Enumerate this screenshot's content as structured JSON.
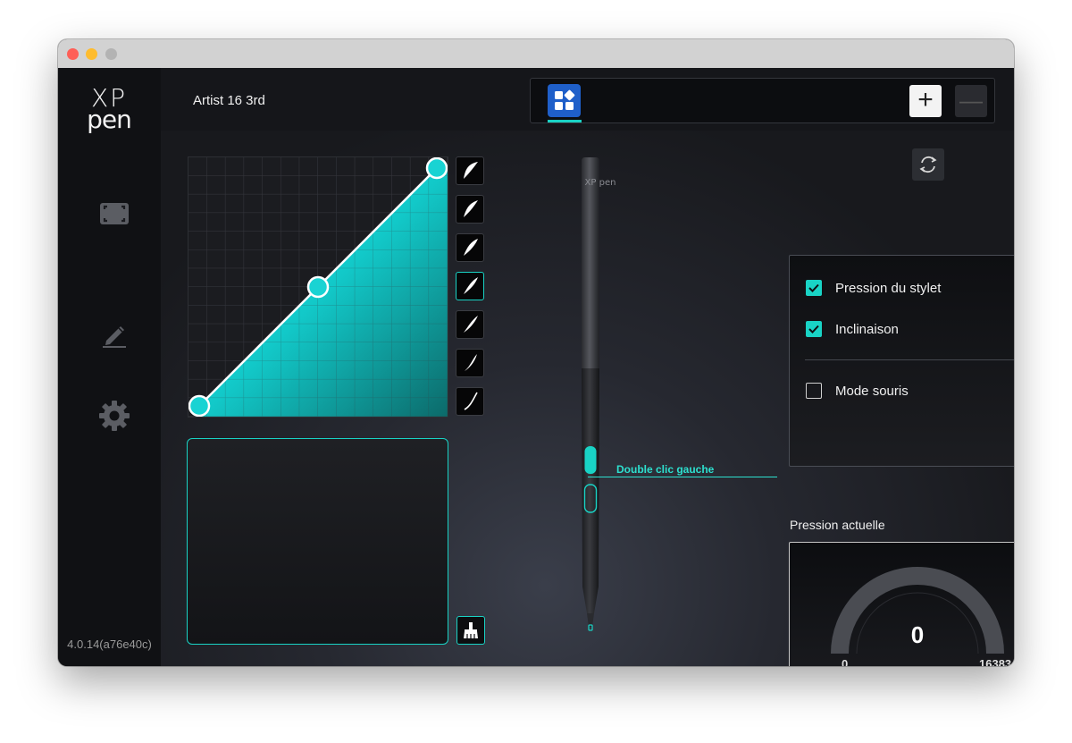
{
  "window": {
    "titlebar": {
      "buttons": [
        "close",
        "minimize",
        "zoom"
      ]
    },
    "colors": {
      "accent": "#19d3c5",
      "app_tile": "#1f5fc9",
      "background": "#141519"
    }
  },
  "sidebar": {
    "logo_line1": "XP",
    "logo_line2": "pen",
    "items": [
      {
        "icon": "screen-mapping-icon"
      },
      {
        "icon": "pen-icon"
      },
      {
        "icon": "gear-icon"
      }
    ],
    "version": "4.0.14(a76e40c)"
  },
  "header": {
    "device_name": "Artist 16 3rd",
    "app_tabs": [
      {
        "icon": "all-apps-icon",
        "selected": true
      }
    ],
    "add_label": "+",
    "remove_label": "—"
  },
  "pressure_curve": {
    "presets_count": 7,
    "selected_preset": 3,
    "control_points": [
      [
        0,
        0
      ],
      [
        0.5,
        0.5
      ],
      [
        1,
        1
      ]
    ]
  },
  "pen": {
    "brand": "XP pen",
    "button_upper_label": "Double clic gauche"
  },
  "options": {
    "pen_pressure": {
      "label": "Pression du stylet",
      "checked": true
    },
    "tilt": {
      "label": "Inclinaison",
      "checked": true
    },
    "mouse_mode": {
      "label": "Mode souris",
      "checked": false
    }
  },
  "pressure": {
    "title": "Pression actuelle",
    "value": "0",
    "min": "0",
    "max": "16383"
  }
}
